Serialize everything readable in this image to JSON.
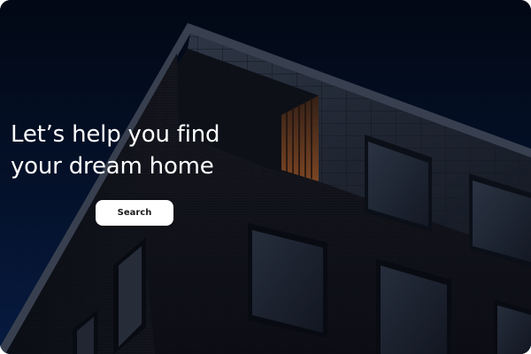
{
  "hero": {
    "headline_line1": "Let’s help you find",
    "headline_line2": "your dream home",
    "search_label": "Search"
  },
  "colors": {
    "sky": "#04112c",
    "button_bg": "#ffffff",
    "text": "#ffffff"
  }
}
